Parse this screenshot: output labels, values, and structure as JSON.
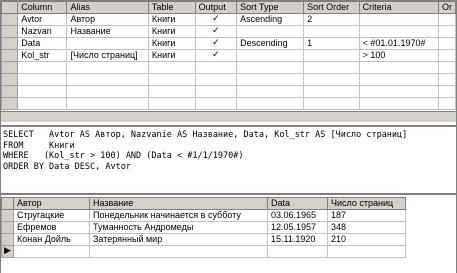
{
  "grid": {
    "headers": [
      "Column",
      "Alias",
      "Table",
      "Output",
      "Sort Type",
      "Sort Order",
      "Criteria",
      "Or"
    ],
    "rows": [
      {
        "column": "Avtor",
        "alias": "Автор",
        "table": "Книги",
        "output": "✓",
        "sort_type": "Ascending",
        "sort_order": "2",
        "criteria": ""
      },
      {
        "column": "Nazvan",
        "alias": "Название",
        "table": "Книги",
        "output": "✓",
        "sort_type": "",
        "sort_order": "",
        "criteria": ""
      },
      {
        "column": "Data",
        "alias": "",
        "table": "Книги",
        "output": "✓",
        "sort_type": "Descending",
        "sort_order": "1",
        "criteria": "< #01.01.1970#"
      },
      {
        "column": "Kol_str",
        "alias": "[Число страниц]",
        "table": "Книги",
        "output": "✓",
        "sort_type": "",
        "sort_order": "",
        "criteria": "> 100"
      }
    ]
  },
  "sql": {
    "line1": "SELECT   Avtor AS Автор, Nazvanie AS Название, Data, Kol_str AS [Число страниц]",
    "line2": "FROM     Книги",
    "line3": "WHERE   (Kol_str > 100) AND (Data < #1/1/1970#)",
    "line4": "ORDER BY Data DESC, Avtor"
  },
  "results": {
    "headers": [
      "Автор",
      "Название",
      "Data",
      "Число страниц"
    ],
    "rows": [
      {
        "author": "Стругацкие",
        "title": "Понедельник начинается в субботу",
        "date": "03.06.1965",
        "pages": "187"
      },
      {
        "author": "Ефремов",
        "title": "Туманность Андромеды",
        "date": "12.05.1957",
        "pages": "348"
      },
      {
        "author": "Конан Дойль",
        "title": "Затерянный мир",
        "date": "15.11.1920",
        "pages": "210"
      }
    ],
    "current_row_marker": "▶"
  }
}
